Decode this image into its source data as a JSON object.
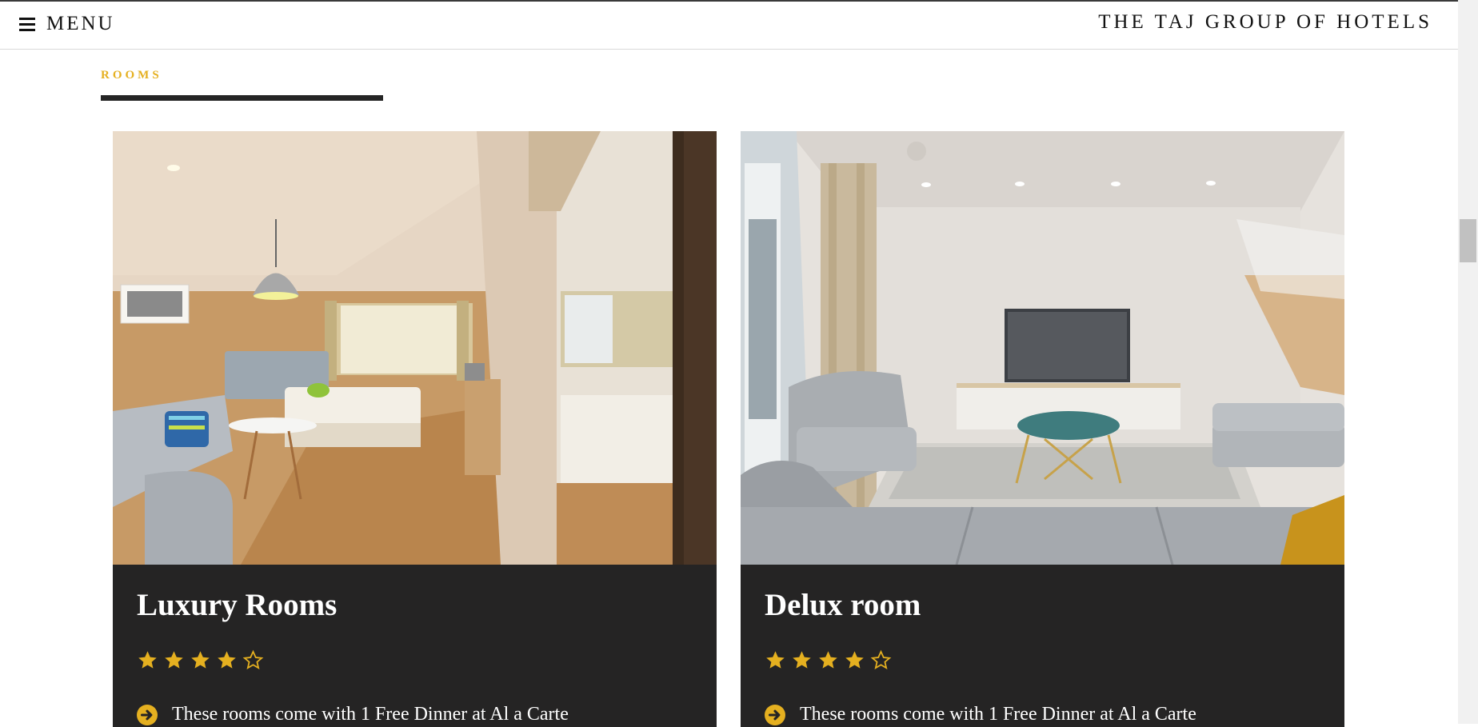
{
  "header": {
    "menu_label": "MENU",
    "brand": "THE TAJ GROUP OF HOTELS",
    "menu_icon": "hamburger-icon"
  },
  "section": {
    "label": "ROOMS"
  },
  "colors": {
    "accent": "#e5b020",
    "card_bg": "#252424",
    "rule": "#252525"
  },
  "rooms": [
    {
      "title": "Luxury Rooms",
      "rating": 4,
      "rating_max": 5,
      "feature": "These rooms come with 1 Free Dinner at Al a Carte",
      "image": "hotel bedroom with mirror door"
    },
    {
      "title": "Delux room",
      "rating": 4,
      "rating_max": 5,
      "feature": "These rooms come with 1 Free Dinner at Al a Carte",
      "image": "living room with gray sofas and tv"
    }
  ]
}
